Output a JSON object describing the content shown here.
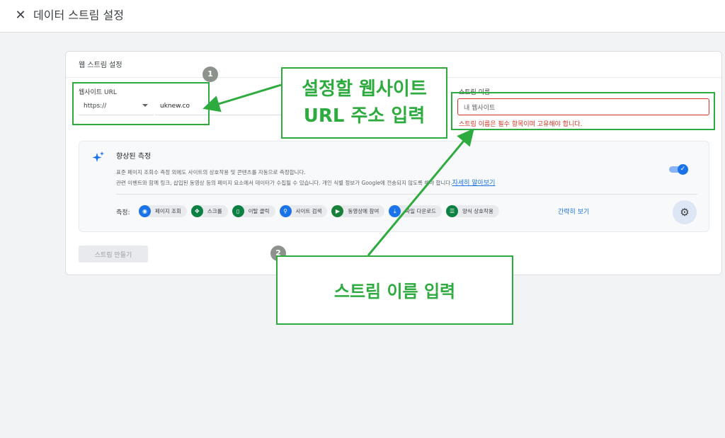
{
  "header": {
    "close_icon": "close-icon",
    "title": "데이터 스트림 설정"
  },
  "card": {
    "title": "웹 스트림 설정",
    "website_url": {
      "label": "웹사이트 URL",
      "protocol": "https://",
      "value": "uknew.co"
    },
    "stream_name": {
      "label": "스트림 이름",
      "placeholder": "내 웹사이트",
      "error": "스트림 이름은 필수 항목이며 고유해야 합니다."
    },
    "enhanced_measurement": {
      "title": "향상된 측정",
      "description_line1": "표준 페이지 조회수 측정 외에도 사이트의 상호작용 및 콘텐츠를 자동으로 측정합니다.",
      "description_line2": "관련 이벤트와 함께 링크, 삽입된 동영상 등의 페이지 요소에서 데이터가 수집될 수 있습니다. 개인 식별 정보가 Google에 전송되지 않도록 해야 합니다.",
      "learn_more": "자세히 알아보기",
      "toggle_enabled": true,
      "measure_label": "측정:",
      "chips": [
        {
          "label": "페이지 조회",
          "icon": "eye-icon"
        },
        {
          "label": "스크롤",
          "icon": "scroll-icon"
        },
        {
          "label": "이탈 클릭",
          "icon": "mouse-icon"
        },
        {
          "label": "사이트 검색",
          "icon": "search-icon"
        },
        {
          "label": "동영상에 참여",
          "icon": "play-icon"
        },
        {
          "label": "파일 다운로드",
          "icon": "download-icon"
        },
        {
          "label": "양식 상호작용",
          "icon": "form-icon"
        }
      ],
      "brief_view": "간략히 보기",
      "settings_icon": "gear-icon"
    },
    "create_button": "스트림 만들기"
  },
  "annotations": {
    "badge1": "1",
    "badge2": "2",
    "callout1_line1": "설정할 웹사이트",
    "callout1_line2": "URL 주소 입력",
    "callout2": "스트림 이름 입력",
    "color": "#2eab3e"
  }
}
